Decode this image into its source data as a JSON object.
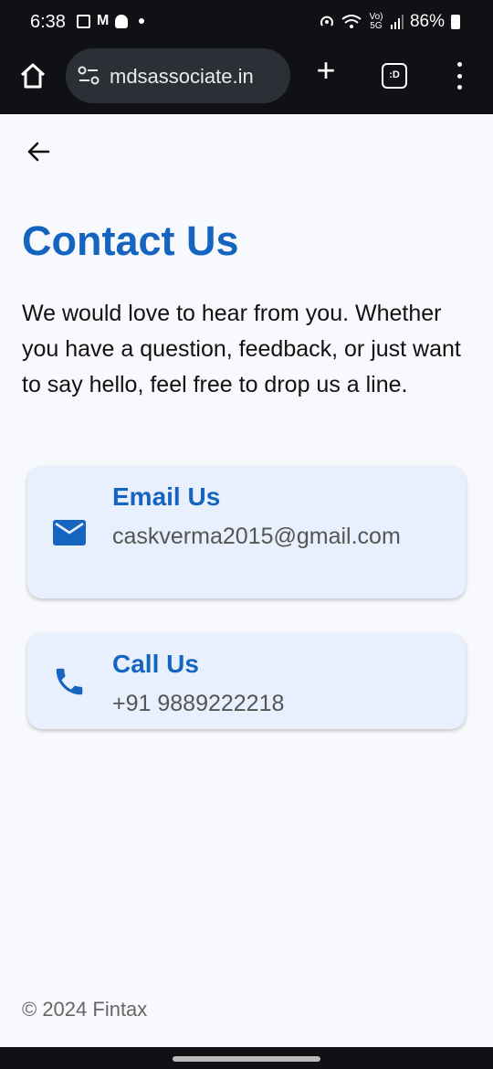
{
  "status_bar": {
    "time": "6:38",
    "network": "Vo) 5G",
    "battery": "86%"
  },
  "browser": {
    "url": "mdsassociate.in",
    "tabs_label": ":D"
  },
  "page": {
    "title": "Contact Us",
    "intro": "We would love to hear from you. Whether you have a question, feedback, or just want to say hello, feel free to drop us a line.",
    "cards": [
      {
        "heading": "Email Us",
        "value": "caskverma2015@gmail.com",
        "icon": "mail-icon"
      },
      {
        "heading": "Call Us",
        "value": "+91 9889222218",
        "icon": "phone-icon"
      }
    ],
    "footer": "© 2024 Fintax"
  },
  "colors": {
    "accent": "#1565c0",
    "card_bg": "#e8f0fd",
    "page_bg": "#f7f9fc",
    "chrome_bg": "#0f1114"
  }
}
